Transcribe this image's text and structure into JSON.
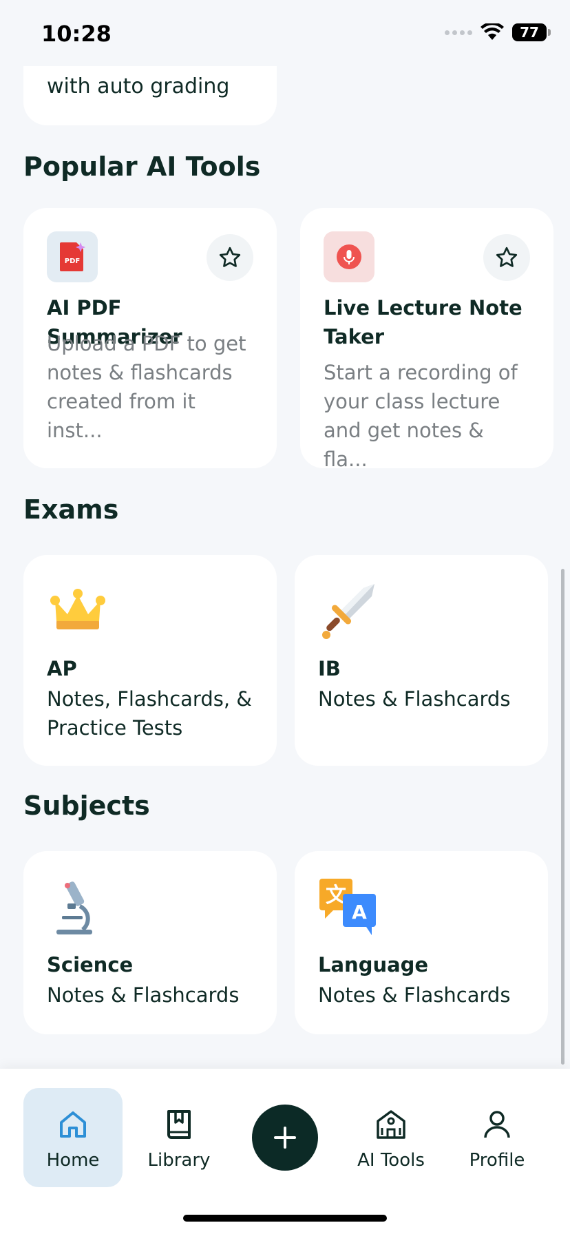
{
  "status_bar": {
    "time": "10:28",
    "battery": "77"
  },
  "partial_card": {
    "text": "with auto grading"
  },
  "sections": {
    "popular_ai_tools": "Popular AI Tools",
    "exams": "Exams",
    "subjects": "Subjects"
  },
  "tools": [
    {
      "title": "AI PDF Summarizer",
      "description_lines": [
        "Upload a PDF to get",
        "notes & flashcards",
        "created from it inst..."
      ],
      "icon": "pdf-icon",
      "icon_bg": "#e3ecf3",
      "accent": "#e53935"
    },
    {
      "title_lines": [
        "Live Lecture Note",
        "Taker"
      ],
      "description_lines": [
        "Start a recording of",
        "your class lecture",
        "and get notes & fla..."
      ],
      "icon": "microphone-icon",
      "icon_bg": "#f7dede",
      "accent": "#ef5350"
    }
  ],
  "exams": [
    {
      "title": "AP",
      "subtitle_lines": [
        "Notes, Flashcards, &",
        "Practice Tests"
      ],
      "icon": "crown-icon"
    },
    {
      "title": "IB",
      "subtitle_lines": [
        "Notes & Flashcards"
      ],
      "icon": "sword-icon"
    }
  ],
  "subjects": [
    {
      "title": "Science",
      "subtitle": "Notes & Flashcards",
      "icon": "microscope-icon"
    },
    {
      "title": "Language",
      "subtitle": "Notes & Flashcards",
      "icon": "translate-icon"
    }
  ],
  "tab_bar": {
    "home": "Home",
    "library": "Library",
    "ai_tools": "AI Tools",
    "profile": "Profile",
    "active_color": "#deebf5",
    "add_button_color": "#0c2a26"
  }
}
